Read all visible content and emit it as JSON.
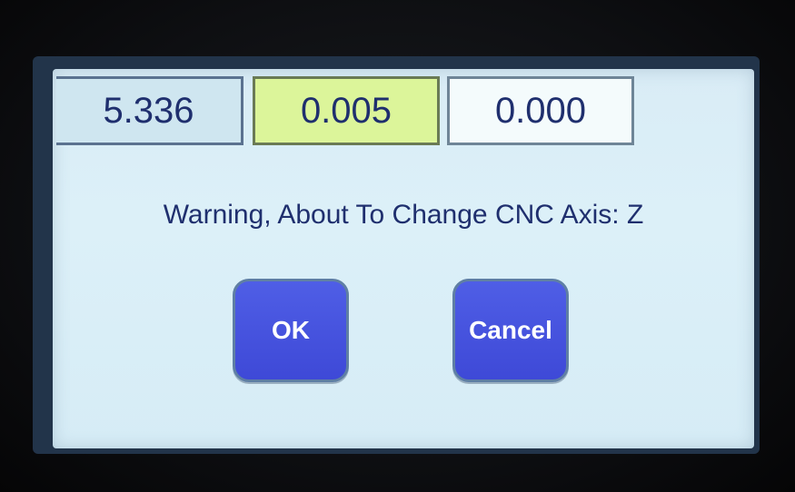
{
  "readouts": [
    {
      "value": "5.336"
    },
    {
      "value": "0.005"
    },
    {
      "value": "0.000"
    }
  ],
  "dialog": {
    "message": "Warning, About To Change CNC Axis: Z",
    "ok_label": "OK",
    "cancel_label": "Cancel"
  },
  "colors": {
    "accent_button": "#4553dd",
    "highlight_readout": "#dcf59a",
    "text": "#1f2f6e",
    "screen_background": "#d9ecf6"
  }
}
